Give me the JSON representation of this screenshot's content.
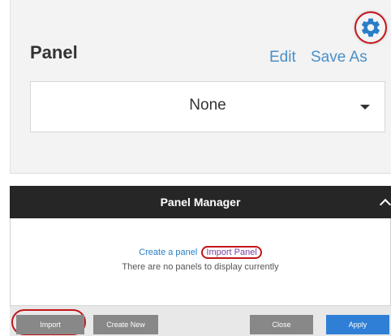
{
  "panel": {
    "title": "Panel",
    "edit_label": "Edit",
    "save_as_label": "Save As",
    "selected_value": "None"
  },
  "manager": {
    "title": "Panel Manager",
    "create_link": "Create a panel",
    "import_link": "Import Panel",
    "empty_message": "There are no panels to display currently",
    "buttons": {
      "import": "Import",
      "create_new": "Create New",
      "close": "Close",
      "apply": "Apply"
    }
  },
  "colors": {
    "link_blue": "#4a90c8",
    "apply_blue": "#2f7fd6",
    "header_dark": "#262626",
    "highlight_red": "#c3151b",
    "gear_blue": "#2a7ec8"
  },
  "icons": {
    "settings": "gear-icon",
    "dropdown": "caret-down-icon",
    "collapse": "chevron-up-icon"
  }
}
